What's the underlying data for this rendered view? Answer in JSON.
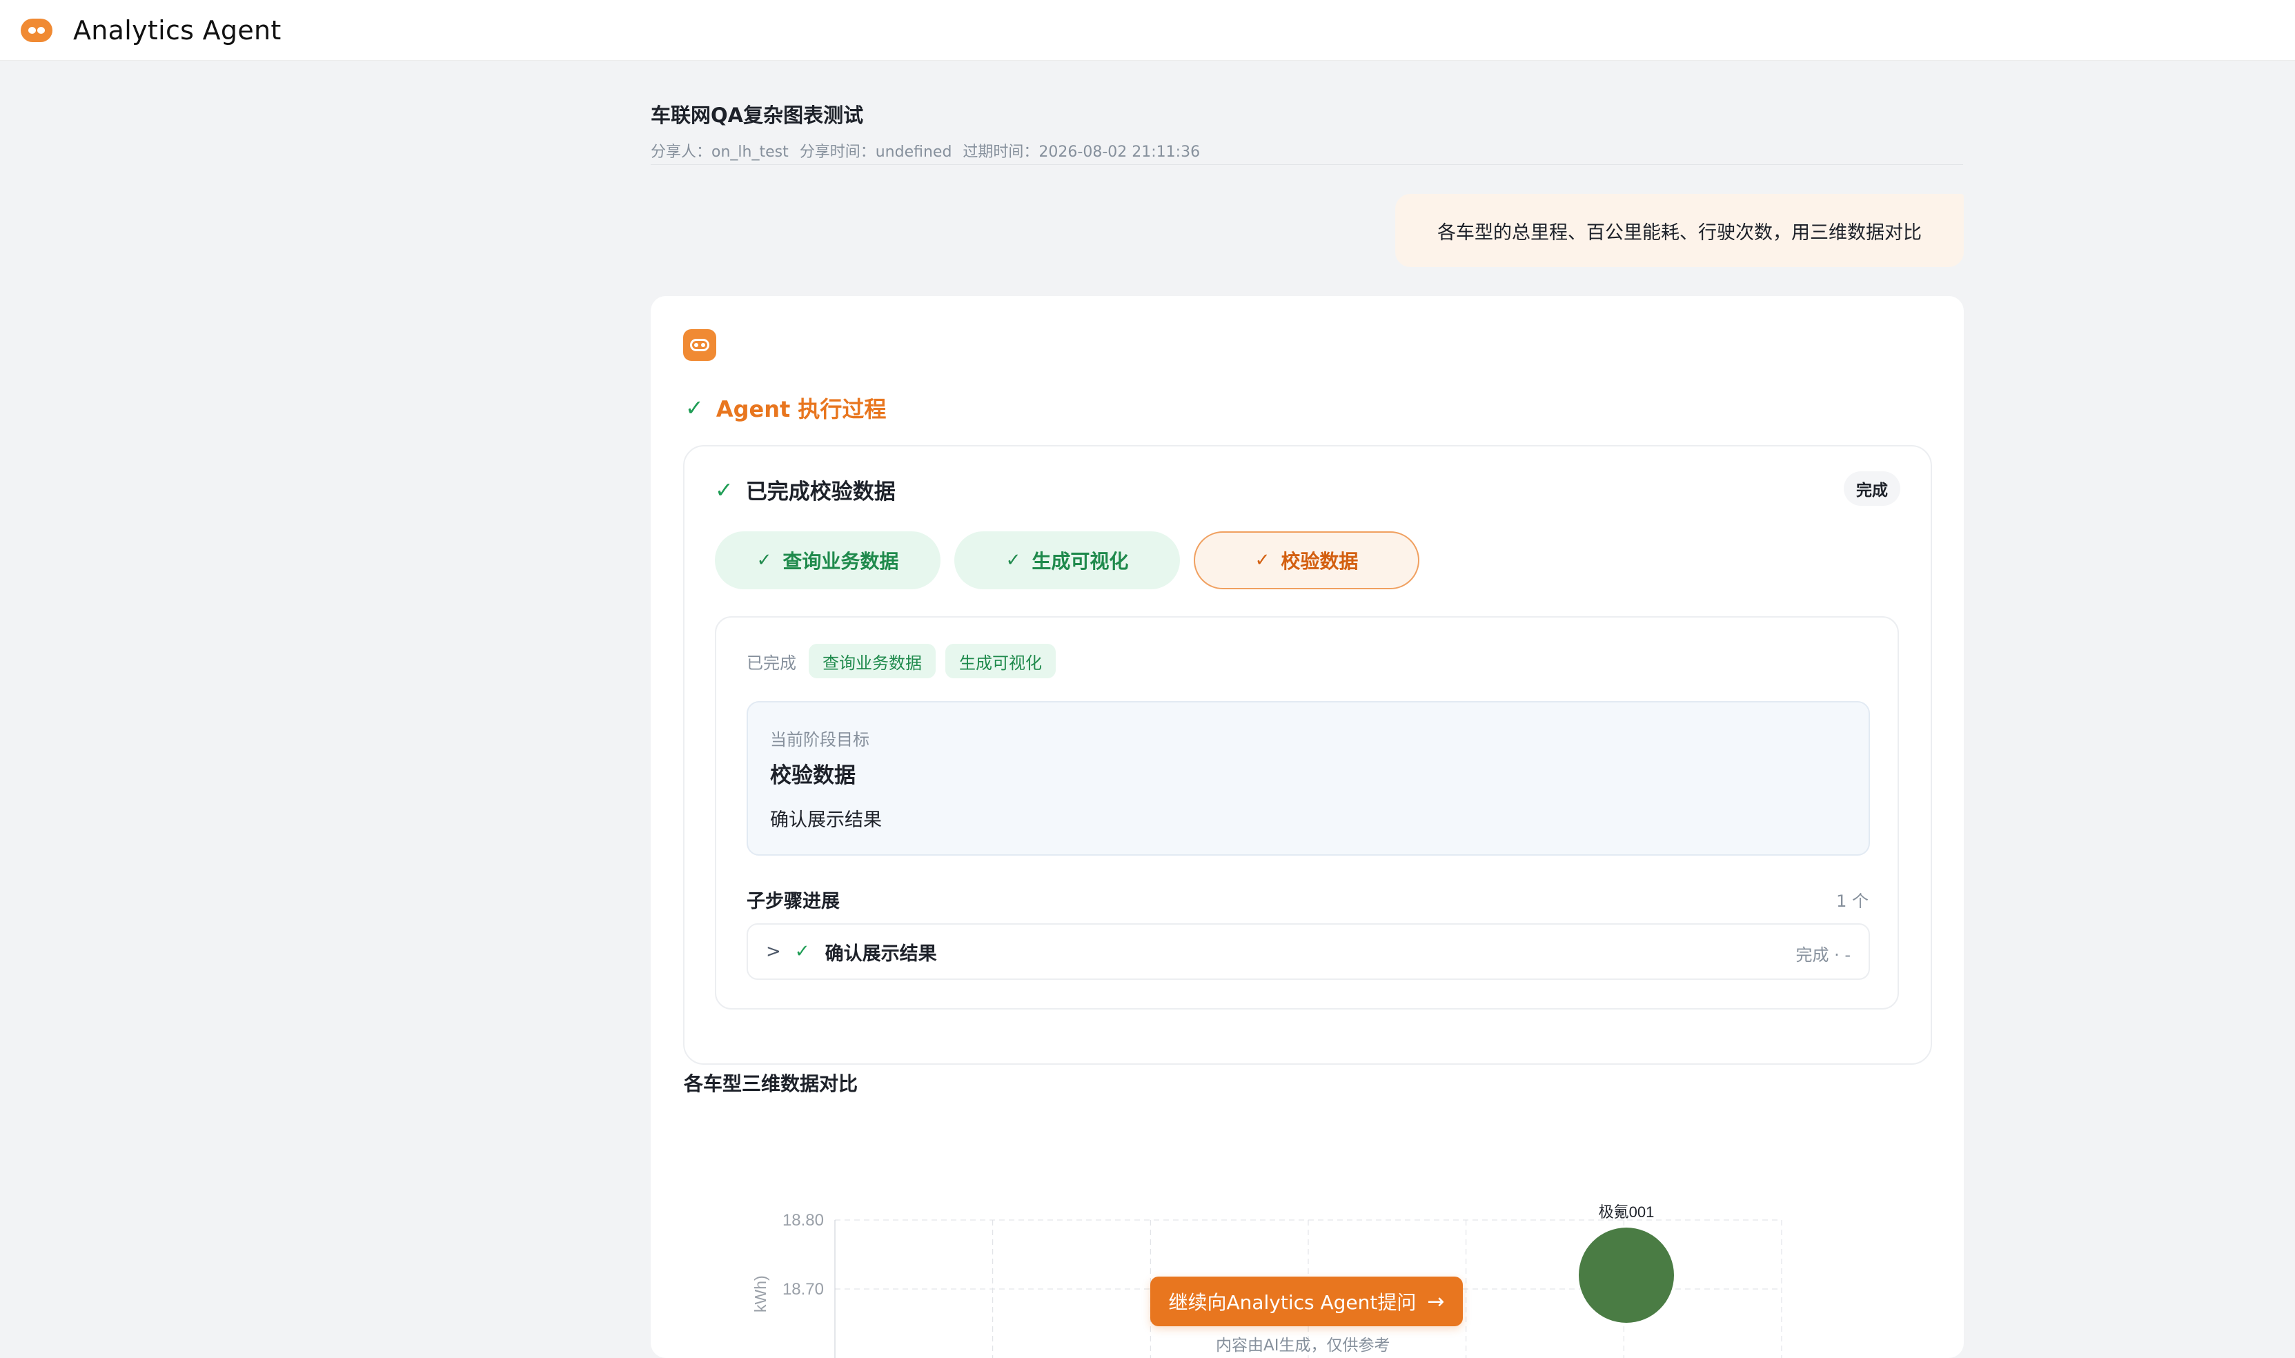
{
  "app": {
    "title": "Analytics Agent"
  },
  "share": {
    "title": "车联网QA复杂图表测试",
    "sharer": "分享人：on_lh_test",
    "share_time": "分享时间：undefined",
    "expire_time": "过期时间：2026-08-02 21:11:36"
  },
  "user_message": "各车型的总里程、百公里能耗、行驶次数，用三维数据对比",
  "agent": {
    "process_label": "Agent 执行过程",
    "status_title": "已完成校验数据",
    "status_badge": "完成",
    "steps": [
      {
        "label": "查询业务数据",
        "state": "done"
      },
      {
        "label": "生成可视化",
        "state": "done"
      },
      {
        "label": "校验数据",
        "state": "active"
      }
    ],
    "completed_label": "已完成",
    "completed_tags": [
      "查询业务数据",
      "生成可视化"
    ],
    "goal": {
      "caption": "当前阶段目标",
      "title": "校验数据",
      "desc": "确认展示结果"
    },
    "substeps": {
      "heading": "子步骤进展",
      "count": "1 个",
      "items": [
        {
          "name": "确认展示结果",
          "status": "完成 · -"
        }
      ]
    }
  },
  "chart_data": {
    "type": "scatter",
    "title": "各车型三维数据对比",
    "y_tick_labels": [
      "18.80",
      "18.70"
    ],
    "ylabel_fragment": "kWh)",
    "points": [
      {
        "label": "极氪001",
        "y": 18.72,
        "color": "#4a7c44"
      }
    ]
  },
  "footer": {
    "ask_button": "继续向Analytics Agent提问",
    "disclaimer": "内容由AI生成，仅供参考"
  }
}
